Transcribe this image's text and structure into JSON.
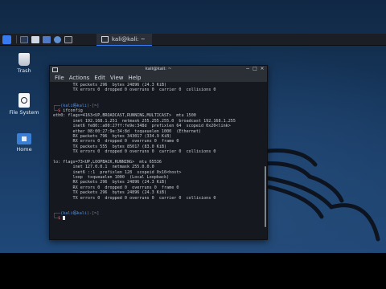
{
  "panel": {
    "task_label": "kali@kali: ~"
  },
  "desktop": {
    "trash_label": "Trash",
    "filesystem_label": "File System",
    "home_label": "Home"
  },
  "terminal": {
    "title": "kali@kali: ~",
    "menu": [
      "File",
      "Actions",
      "Edit",
      "View",
      "Help"
    ],
    "blocks": [
      {
        "kind": "out",
        "text": "        TX packets 296  bytes 24896 (24.3 KiB)"
      },
      {
        "kind": "out",
        "text": "        TX errors 0  dropped 0 overruns 0  carrier 0  collisions 0"
      },
      {
        "kind": "blank"
      },
      {
        "kind": "blank"
      },
      {
        "kind": "prompt1",
        "user": "kali",
        "host": "kali",
        "dir": "~"
      },
      {
        "kind": "prompt2",
        "cmd": "ifconfig"
      },
      {
        "kind": "out",
        "text": "eth0: flags=4163<UP,BROADCAST,RUNNING,MULTICAST>  mtu 1500"
      },
      {
        "kind": "out",
        "text": "        inet 192.168.1.251  netmask 255.255.255.0  broadcast 192.168.1.255"
      },
      {
        "kind": "out",
        "text": "        inet6 fe80::a00:27ff:fe9e:348d  prefixlen 64  scopeid 0x20<link>"
      },
      {
        "kind": "out",
        "text": "        ether 08:00:27:9e:34:8d  txqueuelen 1000  (Ethernet)"
      },
      {
        "kind": "out",
        "text": "        RX packets 796  bytes 343017 (334.9 KiB)"
      },
      {
        "kind": "out",
        "text": "        RX errors 0  dropped 0  overruns 0  frame 0"
      },
      {
        "kind": "out",
        "text": "        TX packets 555  bytes 85017 (83.0 KiB)"
      },
      {
        "kind": "out",
        "text": "        TX errors 0  dropped 0 overruns 0  carrier 0  collisions 0"
      },
      {
        "kind": "blank"
      },
      {
        "kind": "out",
        "text": "lo: flags=73<UP,LOOPBACK,RUNNING>  mtu 65536"
      },
      {
        "kind": "out",
        "text": "        inet 127.0.0.1  netmask 255.0.0.0"
      },
      {
        "kind": "out",
        "text": "        inet6 ::1  prefixlen 128  scopeid 0x10<host>"
      },
      {
        "kind": "out",
        "text": "        loop  txqueuelen 1000  (Local Loopback)"
      },
      {
        "kind": "out",
        "text": "        RX packets 296  bytes 24896 (24.3 KiB)"
      },
      {
        "kind": "out",
        "text": "        RX errors 0  dropped 0  overruns 0  frame 0"
      },
      {
        "kind": "out",
        "text": "        TX packets 296  bytes 24896 (24.3 KiB)"
      },
      {
        "kind": "out",
        "text": "        TX errors 0  dropped 0 overruns 0  carrier 0  collisions 0"
      },
      {
        "kind": "blank"
      },
      {
        "kind": "blank"
      },
      {
        "kind": "prompt1",
        "user": "kali",
        "host": "kali",
        "dir": "~"
      },
      {
        "kind": "prompt2",
        "cmd": ""
      }
    ]
  },
  "colors": {
    "prompt_frame": "#4f8fe0",
    "prompt_hash": "#ff5a5a",
    "accent": "#367bf0"
  }
}
